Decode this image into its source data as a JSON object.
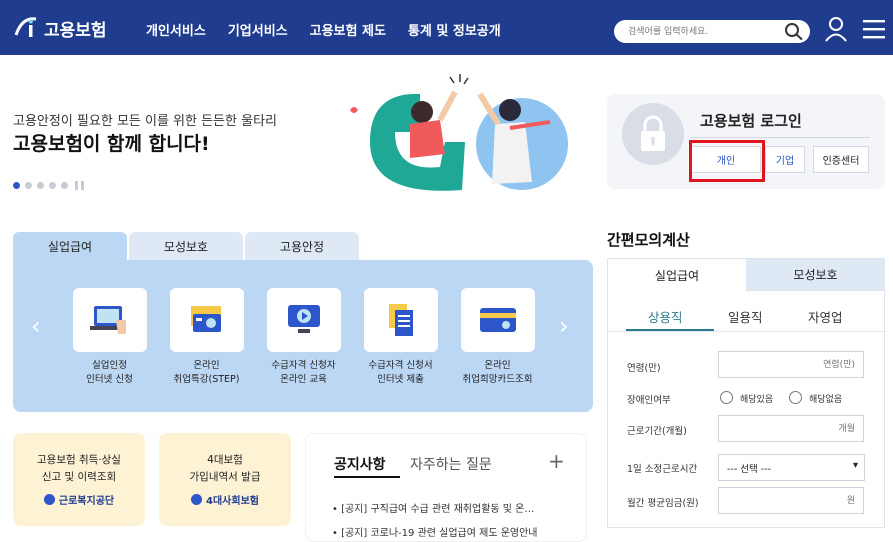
{
  "header": {
    "logo_text": "고용보험",
    "nav": [
      "개인서비스",
      "기업서비스",
      "고용보험 제도",
      "통계 및 정보공개"
    ],
    "search_placeholder": "검색어를 입력하세요."
  },
  "hero": {
    "subtitle": "고용안정이 필요한 모든 이를 위한 든든한 울타리",
    "title": "고용보험이 함께 합니다!"
  },
  "login": {
    "title": "고용보험 로그인",
    "buttons": [
      "개인",
      "기업",
      "인증센터"
    ]
  },
  "tabs": [
    "실업급여",
    "모성보호",
    "고용안정"
  ],
  "services": [
    {
      "label": "실업인정\n인터넷 신청",
      "icon": "laptop-hand-icon"
    },
    {
      "label": "온라인\n취업특강(STEP)",
      "icon": "projector-icon"
    },
    {
      "label": "수급자격 신청자\n온라인 교육",
      "icon": "monitor-play-icon"
    },
    {
      "label": "수급자격 신청서\n인터넷 제출",
      "icon": "document-icon"
    },
    {
      "label": "온라인\n취업희망카드조회",
      "icon": "card-icon"
    }
  ],
  "cards": [
    {
      "text": "고용보험 취득·상실\n신고 및 이력조회",
      "brand": "근로복지공단"
    },
    {
      "text": "4대보험\n가입내역서 발급",
      "brand": "4대사회보험"
    }
  ],
  "notice": {
    "tab_active": "공지사항",
    "tab_other": "자주하는 질문",
    "items": [
      "[공지] 구직급여 수급 관련 재취업활동 및 온…",
      "[공지] 코로나-19 관련 실업급여 제도 운영안내"
    ]
  },
  "calculator": {
    "title": "간편모의계산",
    "tabs": [
      "실업급여",
      "모성보호"
    ],
    "sub_tabs": [
      "상용직",
      "일용직",
      "자영업"
    ],
    "fields": {
      "age_label": "연령(만)",
      "age_placeholder": "연령(만)",
      "disabled_label": "장애인여부",
      "radio_yes": "해당있음",
      "radio_no": "해당없음",
      "period_label": "근로기간(개월)",
      "period_placeholder": "개월",
      "reason_label": "1일 소정근로시간",
      "reason_value": "--- 선택 ---",
      "wage_label": "월간 평균임금(원)",
      "wage_placeholder": "원"
    }
  },
  "colors": {
    "header": "#1f3c8f",
    "panel": "#bcd7f4",
    "highlight": "#e0131f",
    "card": "#fdf2d3"
  }
}
